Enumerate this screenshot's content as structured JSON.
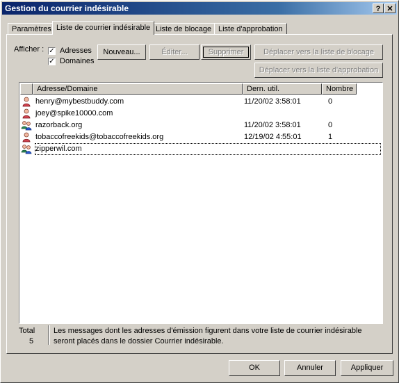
{
  "window": {
    "title": "Gestion du courrier indésirable",
    "help_glyph": "?",
    "close_glyph": "✕"
  },
  "tabs": [
    {
      "label": "Paramètres",
      "active": false
    },
    {
      "label": "Liste de courrier indésirable",
      "active": true
    },
    {
      "label": "Liste de blocage",
      "active": false
    },
    {
      "label": "Liste d'approbation",
      "active": false
    }
  ],
  "filter": {
    "label": "Afficher :",
    "addresses_label": "Adresses",
    "addresses_checked": true,
    "domains_label": "Domaines",
    "domains_checked": true,
    "check_glyph": "✓"
  },
  "actions": {
    "new_label": "Nouveau...",
    "edit_label": "Éditer...",
    "delete_label": "Supprimer",
    "move_block_label": "Déplacer vers la liste de blocage",
    "move_approve_label": "Déplacer vers la liste d'approbation"
  },
  "list": {
    "columns": [
      "Adresse/Domaine",
      "Dern. util.",
      "Nombre"
    ],
    "rows": [
      {
        "address": "henry@mybestbuddy.com",
        "last_used": "11/20/02 3:58:01",
        "count": "0",
        "icon": "person-icon"
      },
      {
        "address": "joey@spike10000.com",
        "last_used": "",
        "count": "",
        "icon": "person-icon"
      },
      {
        "address": "razorback.org",
        "last_used": "11/20/02 3:58:01",
        "count": "0",
        "icon": "group-icon"
      },
      {
        "address": "tobaccofreekids@tobaccofreekids.org",
        "last_used": "12/19/02 4:55:01",
        "count": "1",
        "icon": "person-icon"
      },
      {
        "address": "zipperwil.com",
        "last_used": "",
        "count": "",
        "icon": "group-icon"
      }
    ]
  },
  "footer": {
    "total_label": "Total",
    "total_value": "5",
    "info_line1": "Les messages dont les adresses d'émission figurent dans votre liste de courrier indésirable",
    "info_line2": "seront placés dans le dossier Courrier indésirable."
  },
  "dialog": {
    "ok_label": "OK",
    "cancel_label": "Annuler",
    "apply_label": "Appliquer"
  },
  "colors": {
    "title_start": "#0a246a",
    "title_end": "#a6caf0",
    "face": "#d4d0c8"
  }
}
